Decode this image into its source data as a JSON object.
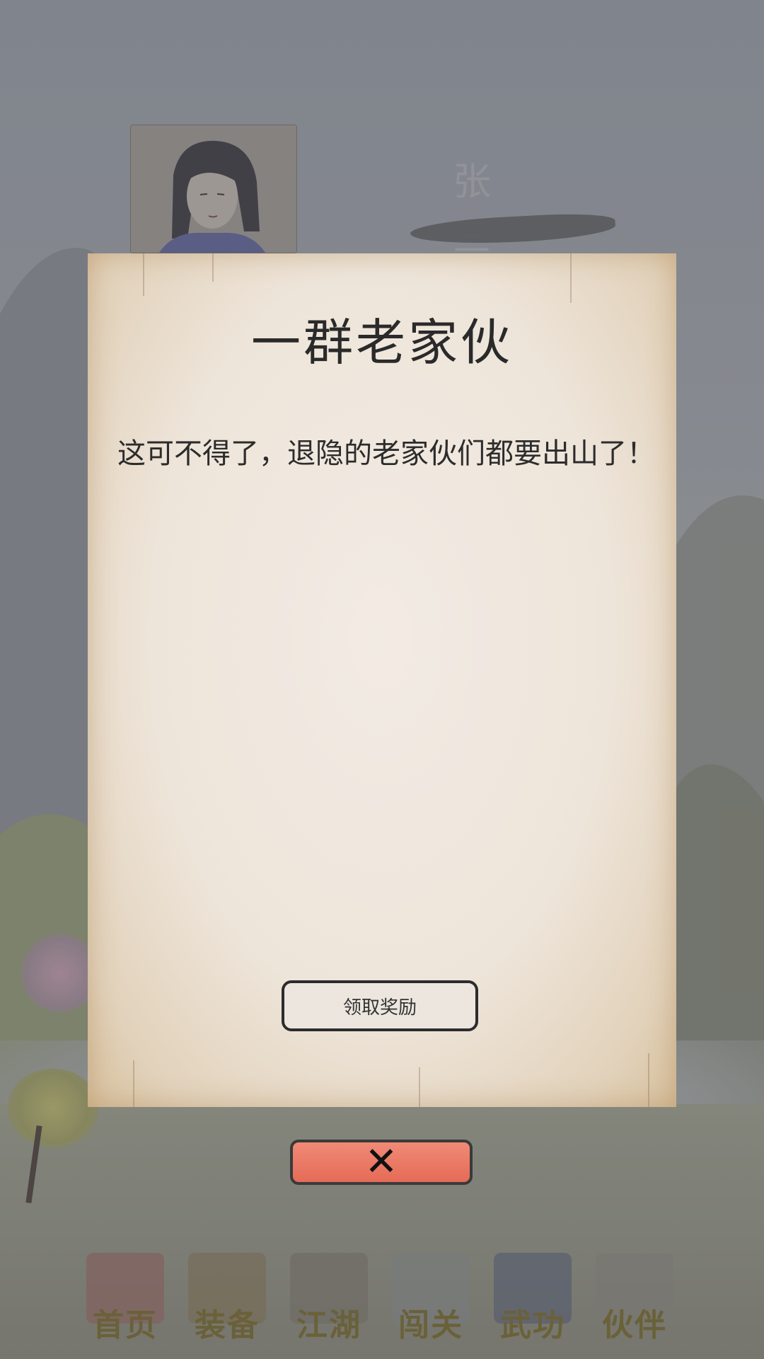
{
  "header": {
    "player_name": "张三"
  },
  "dialog": {
    "title": "一群老家伙",
    "description": "这可不得了，退隐的老家伙们都要出山了！",
    "claim_button": "领取奖励",
    "close_icon": "close-icon"
  },
  "nav": {
    "items": [
      {
        "label": "首页",
        "icon": "home-gate-icon"
      },
      {
        "label": "装备",
        "icon": "armor-icon"
      },
      {
        "label": "江湖",
        "icon": "scroll-icon"
      },
      {
        "label": "闯关",
        "icon": "crossed-swords-icon"
      },
      {
        "label": "武功",
        "icon": "martial-book-icon"
      },
      {
        "label": "伙伴",
        "icon": "companions-icon"
      }
    ]
  },
  "colors": {
    "paper": "#eee5da",
    "close_button": "#e56b57",
    "nav_label": "#6d6234"
  }
}
